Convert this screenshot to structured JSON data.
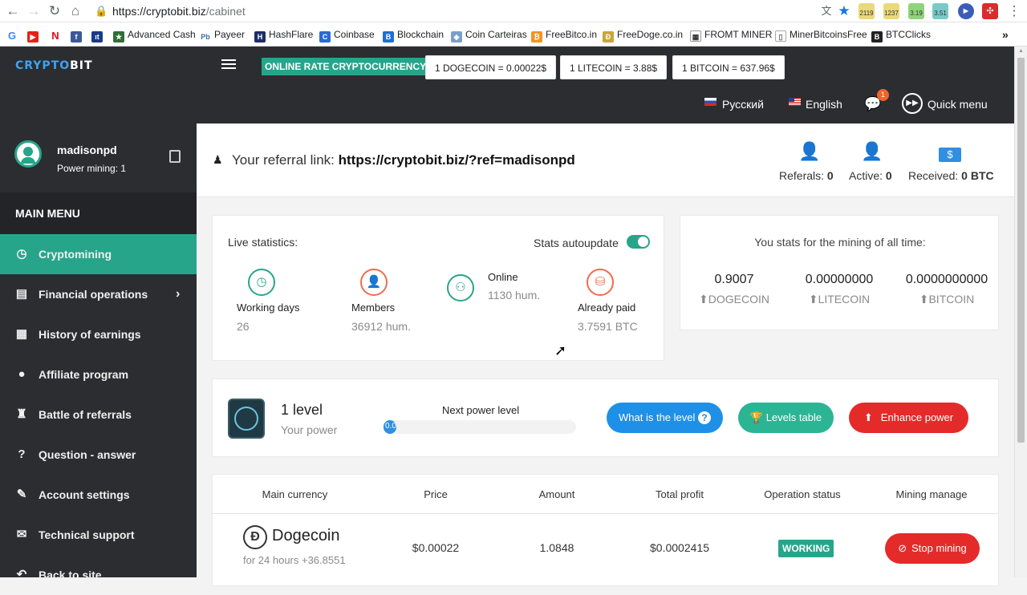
{
  "browser": {
    "url_host": "https://cryptobit.biz",
    "url_path": "/cabinet",
    "extension_counts": [
      "2119",
      "1237",
      "3.19",
      "3.51"
    ],
    "bookmarks": [
      "Advanced Cash",
      "Payeer",
      "HashFlare",
      "Coinbase",
      "Blockchain",
      "Coin Carteiras",
      "FreeBitco.in",
      "FreeDoge.co.in",
      "FROMT MINER",
      "MinerBitcoinsFree",
      "BTCClicks"
    ],
    "bookmark_overflow": "»"
  },
  "header": {
    "logo_left": "CRYPTO",
    "logo_right": "BIT",
    "online_rate_label": "ONLINE RATE CRYPTOCURRENCY",
    "rates": [
      "1 DOGECOIN = 0.00022$",
      "1 LITECOIN = 3.88$",
      "1 BITCOIN = 637.96$"
    ],
    "lang_ru": "Русский",
    "lang_en": "English",
    "chat_badge": "1",
    "quick_menu": "Quick menu"
  },
  "sidebar": {
    "username": "madisonpd",
    "power_mining": "Power mining: 1",
    "main_menu": "MAIN MENU",
    "items": [
      {
        "label": "Cryptomining",
        "icon": "gauge-icon"
      },
      {
        "label": "Financial operations",
        "icon": "wallet-icon"
      },
      {
        "label": "History of earnings",
        "icon": "calendar-icon"
      },
      {
        "label": "Affiliate program",
        "icon": "user-icon"
      },
      {
        "label": "Battle of referrals",
        "icon": "chess-icon"
      },
      {
        "label": "Question - answer",
        "icon": "question-icon"
      },
      {
        "label": "Account settings",
        "icon": "wrench-icon"
      },
      {
        "label": "Technical support",
        "icon": "mail-icon"
      },
      {
        "label": "Back to site",
        "icon": "back-icon"
      }
    ],
    "submenu_arrow": "›"
  },
  "referral": {
    "label": "Your referral link:",
    "link": "https://cryptobit.biz/?ref=madisonpd",
    "referals_label": "Referals:",
    "referals_value": "0",
    "active_label": "Active:",
    "active_value": "0",
    "received_label": "Received:",
    "received_value": "0 BTC"
  },
  "live": {
    "title": "Live statistics:",
    "autoupdate": "Stats autoupdate",
    "autoupdate_on": true,
    "working_days_label": "Working days",
    "working_days_value": "26",
    "members_label": "Members",
    "members_value": "36912 hum.",
    "online_label": "Online",
    "online_value": "1130 hum.",
    "paid_label": "Already paid",
    "paid_value": "3.7591 BTC"
  },
  "alltime": {
    "title": "You stats for the mining of all time:",
    "doge_value": "0.9007",
    "doge_label": "DOGECOIN",
    "ltc_value": "0.00000000",
    "ltc_label": "LITECOIN",
    "btc_value": "0.0000000000",
    "btc_label": "BITCOIN"
  },
  "level": {
    "level_text": "1 level",
    "your_power": "Your power",
    "next_level": "Next power level",
    "progress_text": "0.0",
    "progress": 0.0,
    "what_is": "What is the level",
    "what_is_q": "?",
    "levels_table": "Levels table",
    "enhance": "Enhance power"
  },
  "table": {
    "headers": [
      "Main currency",
      "Price",
      "Amount",
      "Total profit",
      "Operation status",
      "Mining manage"
    ],
    "row": {
      "currency": "Dogecoin",
      "currency_symbol": "Đ",
      "sub": "for 24 hours +36.8551",
      "price": "$0.00022",
      "amount": "1.0848",
      "profit": "$0.0002415",
      "status": "WORKING",
      "action": "Stop mining"
    }
  },
  "colors": {
    "sidebar_bg": "#2b2d31",
    "accent_green": "#27a58a",
    "button_blue": "#1e90e8",
    "button_teal": "#2bb594",
    "button_red": "#e52a2a",
    "icon_blue": "#2f8fe0"
  }
}
